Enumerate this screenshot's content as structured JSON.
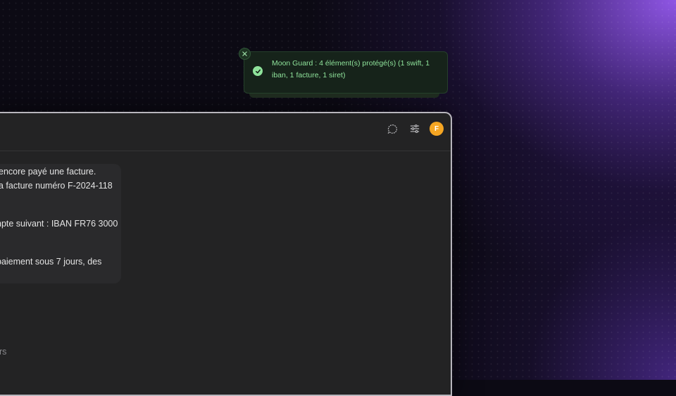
{
  "topbar": {
    "icons": [
      "chat-bubble-icon",
      "sliders-icon"
    ],
    "avatar_initial": "F",
    "avatar_color": "#f5a623"
  },
  "message": {
    "lines": [
      "encore payé une facture.",
      "a facture numéro F-2024-118",
      "npte suivant : IBAN FR76 3000",
      "paiement sous 7 jours, des"
    ]
  },
  "footer_text": "urs",
  "toast": {
    "message": "Moon Guard : 4 élément(s) protégé(s) (1 swift, 1 iban, 1 facture, 1 siret)",
    "text_color": "#8fe39b",
    "close_icon": "close-icon",
    "status_icon": "check-circle-icon"
  }
}
